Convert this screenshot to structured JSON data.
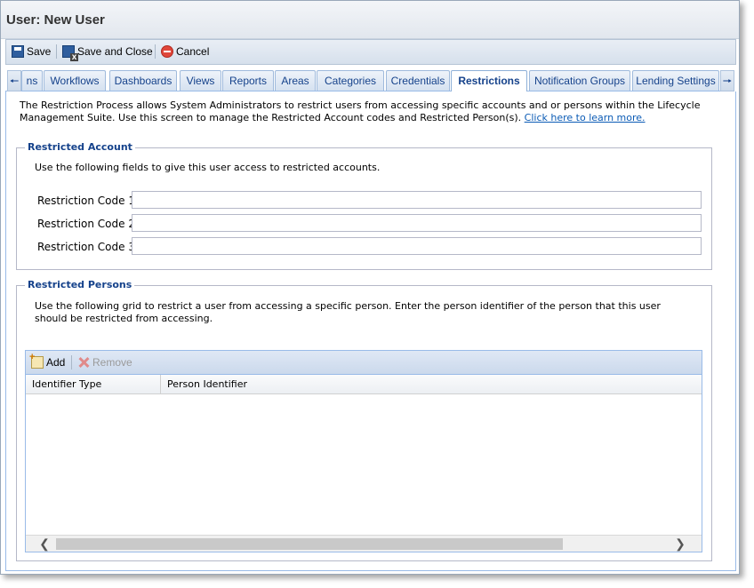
{
  "window": {
    "title": "User: New User"
  },
  "toolbar": {
    "save_label": "Save",
    "save_close_label": "Save and Close",
    "cancel_label": "Cancel"
  },
  "tabs": [
    {
      "label": "ns"
    },
    {
      "label": "Workflows"
    },
    {
      "label": "Dashboards"
    },
    {
      "label": "Views"
    },
    {
      "label": "Reports"
    },
    {
      "label": "Areas"
    },
    {
      "label": "Categories"
    },
    {
      "label": "Credentials"
    },
    {
      "label": "Restrictions",
      "active": true
    },
    {
      "label": "Notification Groups"
    },
    {
      "label": "Lending Settings"
    }
  ],
  "intro": {
    "text": "The Restriction Process allows System Administrators to restrict users from accessing specific accounts and or persons within the Lifecycle Management Suite. Use this screen to manage the Restricted Account codes and Restricted Person(s).",
    "link": "Click here to learn more."
  },
  "restricted_account": {
    "legend": "Restricted Account",
    "description": "Use the following fields to give this user access to restricted accounts.",
    "fields": [
      {
        "label": "Restriction Code 1:",
        "value": ""
      },
      {
        "label": "Restriction Code 2:",
        "value": ""
      },
      {
        "label": "Restriction Code 3:",
        "value": ""
      }
    ]
  },
  "restricted_persons": {
    "legend": "Restricted Persons",
    "description": "Use the following grid to restrict a user from accessing a specific person. Enter the person identifier of the person that this user should be restricted from accessing.",
    "add_label": "Add",
    "remove_label": "Remove",
    "columns": [
      "Identifier Type",
      "Person Identifier"
    ],
    "rows": []
  },
  "icons": {
    "save": "save-icon",
    "save_close": "save-close-icon",
    "cancel": "cancel-icon",
    "tab_left": "arrow-left-icon",
    "tab_right": "arrow-right-icon",
    "add": "add-icon",
    "remove": "remove-icon",
    "scroll_left": "chevron-left-icon",
    "scroll_right": "chevron-right-icon"
  },
  "colors": {
    "accent": "#15428b",
    "link": "#0b5bb5",
    "border": "#99bbe8"
  }
}
